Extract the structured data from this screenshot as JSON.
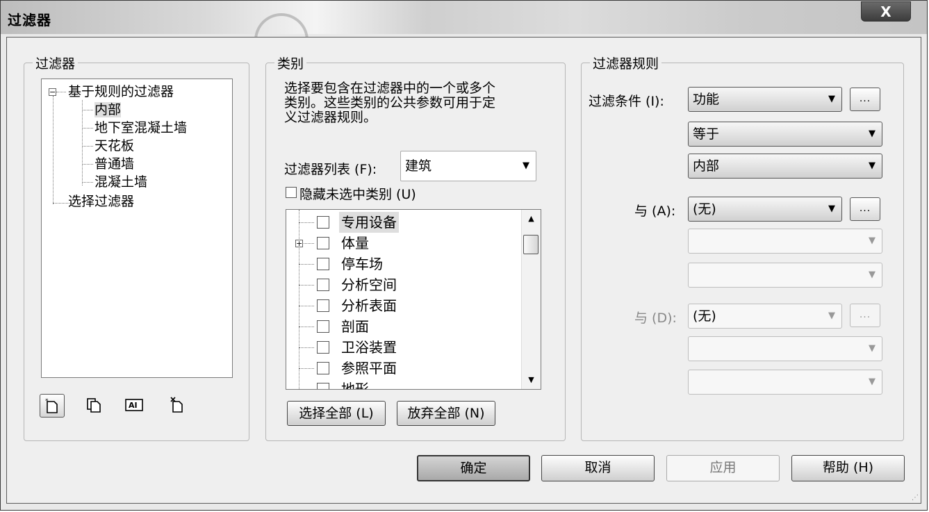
{
  "window": {
    "title": "过滤器",
    "close_label": "X"
  },
  "filters_group": {
    "label": "过滤器",
    "tree": {
      "root": "基于规则的过滤器",
      "children": [
        "内部",
        "地下室混凝土墙",
        "天花板",
        "普通墙",
        "混凝土墙"
      ],
      "selection_root": "选择过滤器"
    },
    "toolbar": {
      "rename_text": "AI"
    }
  },
  "categories_group": {
    "label": "类别",
    "description_lines": [
      "选择要包含在过滤器中的一个或多个",
      "类别。这些类别的公共参数可用于定",
      "义过滤器规则。"
    ],
    "filter_list_label": "过滤器列表 (F):",
    "filter_list_value": "建筑",
    "hide_unchecked_label": "隐藏未选中类别 (U)",
    "items": [
      "专用设备",
      "体量",
      "停车场",
      "分析空间",
      "分析表面",
      "剖面",
      "卫浴装置",
      "参照平面",
      "地形"
    ],
    "select_all": "选择全部 (L)",
    "deselect_all": "放弃全部 (N)"
  },
  "rules_group": {
    "label": "过滤器规则",
    "filter_by_label": "过滤条件 (I):",
    "filter_by_value": "功能",
    "operator_value": "等于",
    "value_value": "内部",
    "and1_label": "与 (A):",
    "and1_value": "(无)",
    "and2_label": "与 (D):",
    "and2_value": "(无)",
    "more_label": "..."
  },
  "buttons": {
    "ok": "确定",
    "cancel": "取消",
    "apply": "应用",
    "help": "帮助 (H)"
  }
}
